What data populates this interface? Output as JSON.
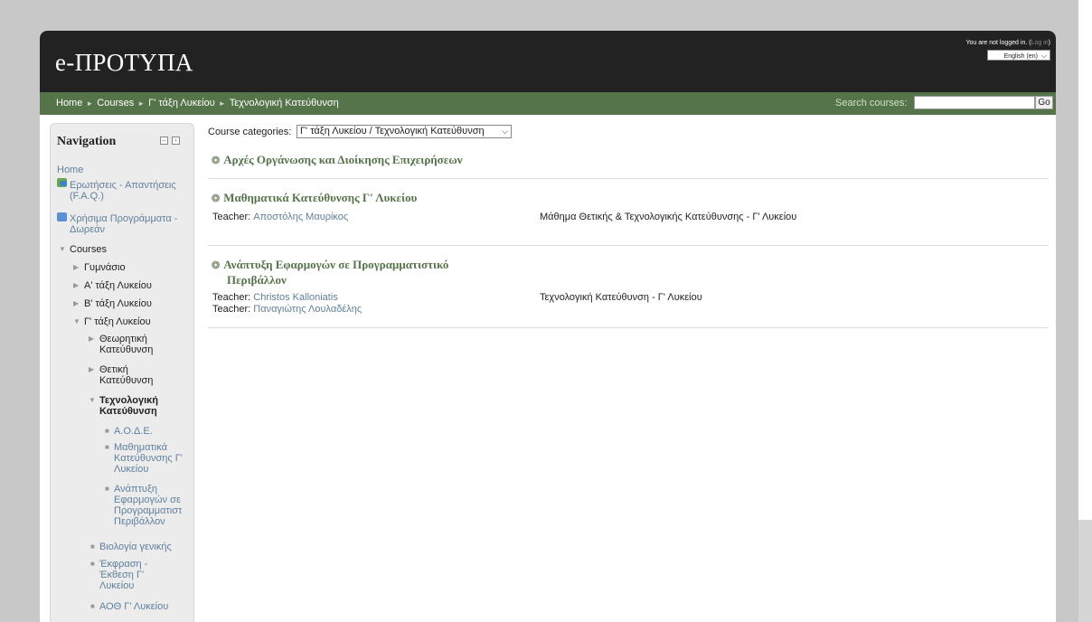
{
  "header": {
    "site_title": "e-ΠΡΟΤΥΠΑ",
    "login_text": "You are not logged in. (",
    "login_link": "Log in",
    "login_end": ")",
    "language": "English (en)"
  },
  "navbar": {
    "breadcrumb": [
      "Home",
      "Courses",
      "Γ' τάξη Λυκείου",
      "Τεχνολογική Κατεύθυνση"
    ],
    "search_label": "Search courses:",
    "search_value": "",
    "go_label": "Go"
  },
  "navigation": {
    "title": "Navigation",
    "home": "Home",
    "faq": "Ερωτήσεις - Απαντήσεις (F.A.Q.)",
    "programs": "Χρήσιμα Προγράμματα - Δωρεάν",
    "courses": "Courses",
    "gymnasio": "Γυμνάσιο",
    "a_lykeiou": "Α' τάξη Λυκείου",
    "b_lykeiou": "Β' τάξη Λυκείου",
    "g_lykeiou": "Γ' τάξη Λυκείου",
    "theoritiki": "Θεωρητική Κατεύθυνση",
    "thetiki": "Θετική Κατεύθυνση",
    "technologiki": "Τεχνολογική Κατεύθυνση",
    "aode": "Α.Ο.Δ.Ε.",
    "mathimatika": "Μαθηματικά Κατεύθυνσης Γ' Λυκείου",
    "anaptyxi": "Ανάπτυξη Εφαρμογών σε Προγραμματιστ Περιβάλλον",
    "biologia": "Βιολογία γενικής",
    "ekfrasi": "Έκφραση - Έκθεση Γ' Λυκείου",
    "aoth": "ΑΟΘ Γ' Λυκείου"
  },
  "main": {
    "category_label": "Course categories:",
    "category_value": "Γ' τάξη Λυκείου / Τεχνολογική Κατεύθυνση",
    "courses": [
      {
        "title": "Αρχές Οργάνωσης και Διοίκησης Επιχειρήσεων"
      },
      {
        "title": "Μαθηματικά Κατεύθυνσης Γ' Λυκείου",
        "teacher_label": "Teacher",
        "teacher1": "Αποστόλης Μαυρίκος",
        "summary": "Μάθημα Θετικής & Τεχνολογικής Κατεύθυνσης - Γ' Λυκείου"
      },
      {
        "title_line1": "Ανάπτυξη Εφαρμογών σε Προγραμματιστικό",
        "title_line2": "Περιβάλλον",
        "teacher_label": "Teacher",
        "teacher1": "Christos Kalloniatis",
        "teacher2": "Παναγιώτης Λουλαδέλης",
        "summary": "Τεχνολογική Κατεύθυνση - Γ' Λυκείου"
      }
    ]
  }
}
